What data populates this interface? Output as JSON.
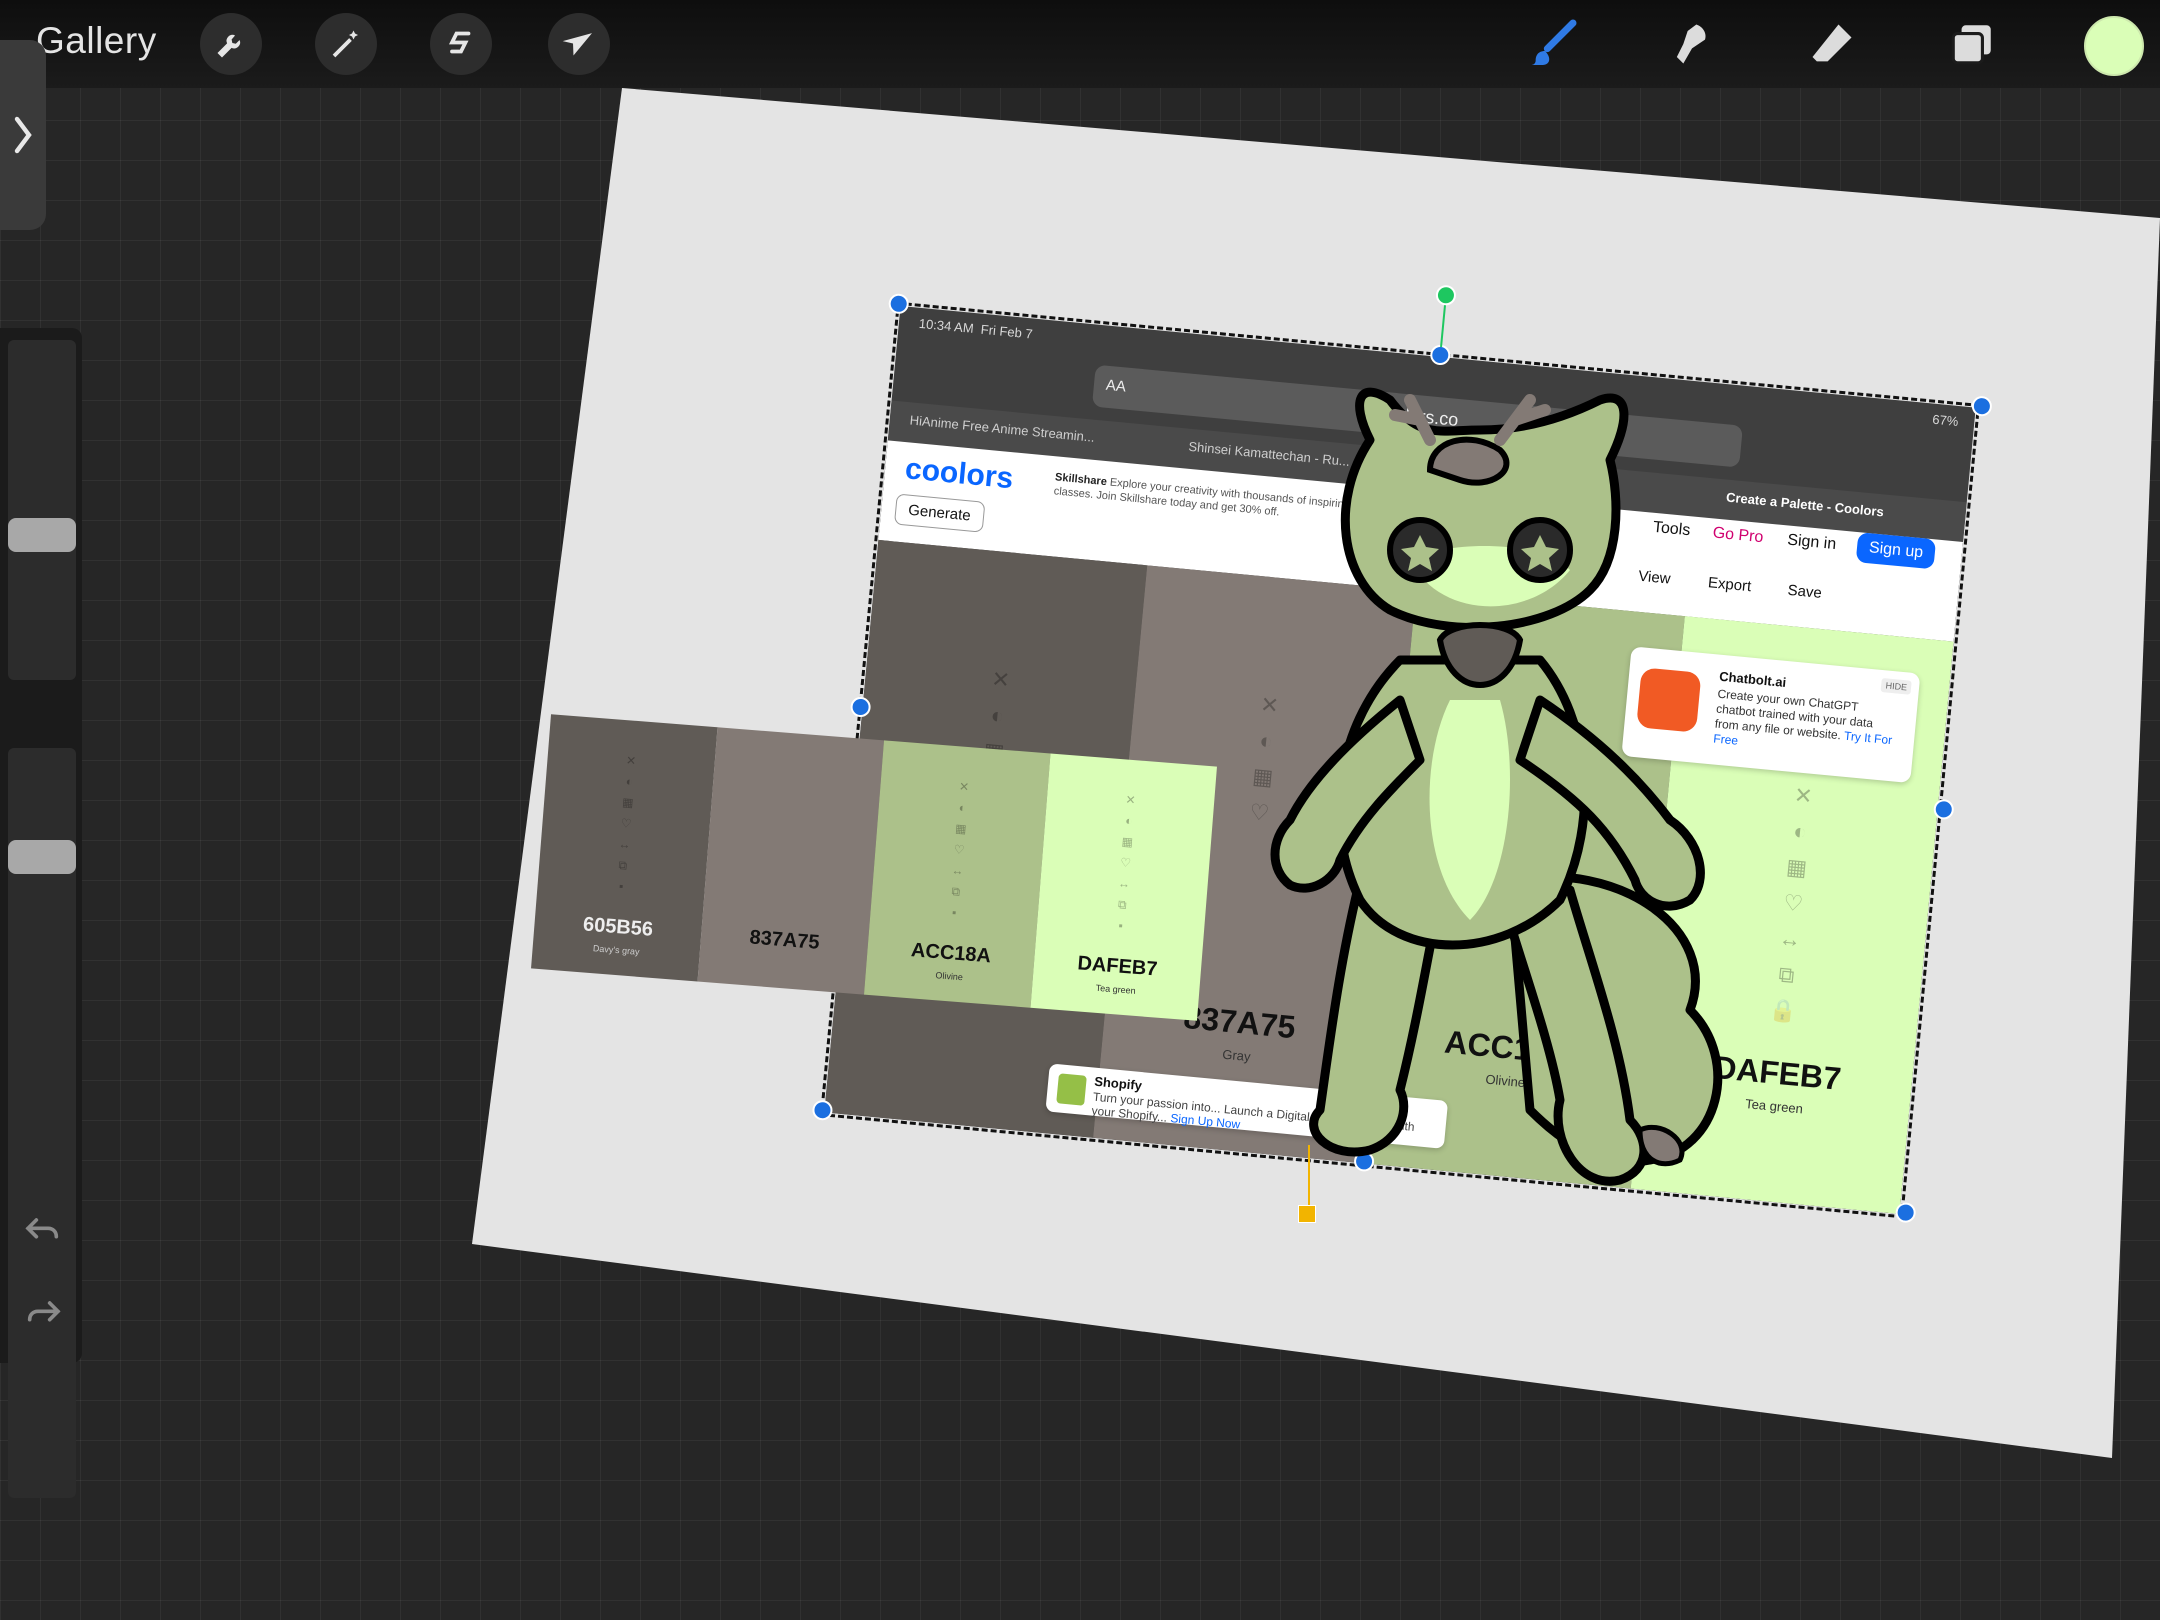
{
  "app": {
    "gallery_label": "Gallery",
    "current_color": "#DAFEB7"
  },
  "toolbar_left": [
    "wrench-icon",
    "magic-wand-icon",
    "selection-icon",
    "transform-arrow-icon"
  ],
  "toolbar_right": [
    "brush-icon",
    "smudge-icon",
    "eraser-icon",
    "layers-icon"
  ],
  "sidebar": {
    "undo_icon": "undo-icon",
    "redo_icon": "redo-icon"
  },
  "snapshot": {
    "status_time": "10:34 AM",
    "status_date": "Fri Feb 7",
    "battery": "67%",
    "url_aa": "AA",
    "url": "coolors.co",
    "tabs": [
      "HiAnime Free Anime Streamin...",
      "Shinsei Kamattechan - Ru...",
      "Create a Palette - Coolors"
    ],
    "site": {
      "logo": "coolors",
      "ad_title": "Skillshare",
      "ad_text": "Explore your creativity with thousands of inspiring classes. Join Skillshare today and get 30% off.",
      "generate": "Generate",
      "tools": "Tools",
      "go_pro": "Go Pro",
      "sign_in": "Sign in",
      "sign_up": "Sign up",
      "view": "View",
      "export": "Export",
      "save": "Save"
    },
    "columns": [
      {
        "hex": "#605B56",
        "code": "605B56",
        "name": "Davy's gray"
      },
      {
        "hex": "#837A75",
        "code": "837A75",
        "name": "Gray"
      },
      {
        "hex": "#ACC18A",
        "code": "ACC18A",
        "name": "Olivine"
      },
      {
        "hex": "#DAFEB7",
        "code": "DAFEB7",
        "name": "Tea green"
      }
    ],
    "chatbolt": {
      "title": "Chatbolt.ai",
      "body": "Create your own ChatGPT chatbot trained with your data from any file or website.",
      "link": "Try It For Free",
      "hide": "HIDE"
    },
    "shopify": {
      "title": "Shopify",
      "body": "Turn your passion into... Launch a Digital Products store with your Shopify...",
      "link": "Sign Up Now"
    }
  },
  "palette_strip": [
    {
      "hex": "#605B56",
      "code": "605B56",
      "name": "Davy's gray"
    },
    {
      "hex": "#837A75",
      "code": "837A75",
      "name": ""
    },
    {
      "hex": "#ACC18A",
      "code": "ACC18A",
      "name": "Olivine"
    },
    {
      "hex": "#DAFEB7",
      "code": "DAFEB7",
      "name": "Tea green"
    }
  ]
}
